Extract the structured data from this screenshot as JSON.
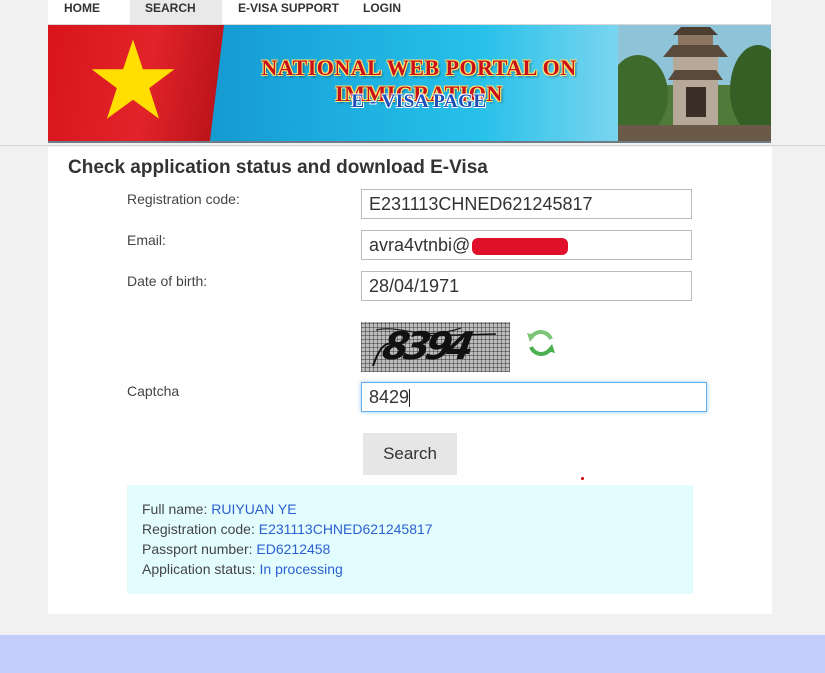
{
  "nav": {
    "items": [
      {
        "label": "HOME"
      },
      {
        "label": "SEARCH"
      },
      {
        "label": "E-VISA SUPPORT"
      },
      {
        "label": "LOGIN"
      }
    ]
  },
  "banner": {
    "title": "NATIONAL WEB PORTAL ON IMMIGRATION",
    "subtitle": "E - VISA PAGE"
  },
  "form": {
    "title": "Check application status and download E-Visa",
    "registration_code_label": "Registration code:",
    "registration_code_value": "E231113CHNED621245817",
    "email_label": "Email:",
    "email_value": "avra4vtnbi@",
    "dob_label": "Date of birth:",
    "dob_value": "28/04/1971",
    "captcha_image_text": "8394",
    "captcha_label": "Captcha",
    "captcha_value": "8429",
    "search_label": "Search"
  },
  "result": {
    "full_name_label": "Full name: ",
    "full_name_value": "RUIYUAN YE",
    "reg_code_label": "Registration code: ",
    "reg_code_value": "E231113CHNED621245817",
    "passport_label": "Passport number: ",
    "passport_value": "ED6212458",
    "status_label": "Application status: ",
    "status_value": "In processing"
  },
  "colors": {
    "link": "#2b5fd0",
    "result_bg": "#e3fdff",
    "footer": "#c3cdfa",
    "flag_red": "#da251d",
    "flag_star": "#ffde00"
  }
}
